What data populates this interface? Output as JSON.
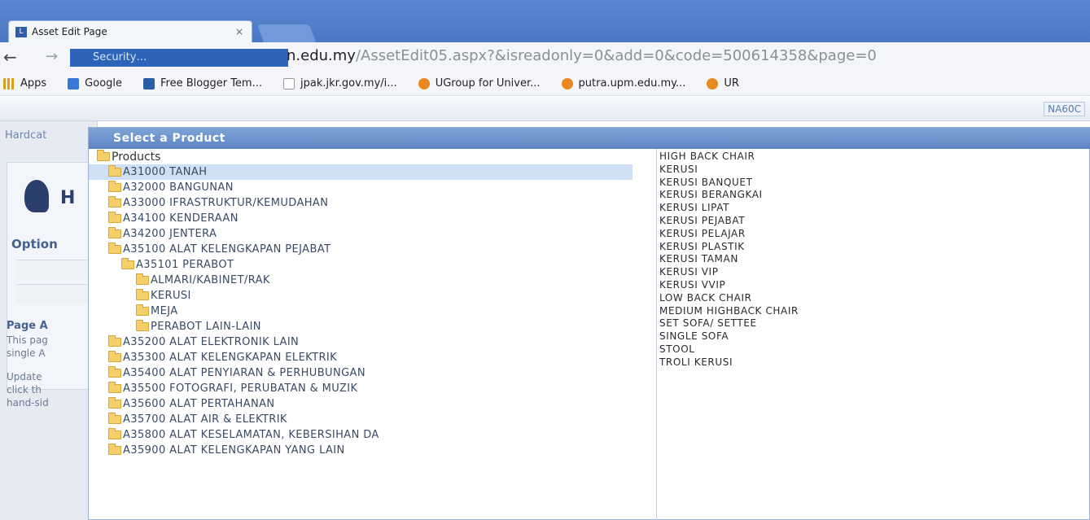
{
  "browser": {
    "tab_title": "Asset Edit Page",
    "tab_close": "×",
    "security_chip": "Security",
    "url_host": "n.edu.my",
    "url_path": "/AssetEdit05.aspx?&isreadonly=0&add=0&code=500614358&page=0",
    "bookmarks": [
      {
        "label": "Apps",
        "icon": "apps-icon"
      },
      {
        "label": "Google",
        "icon": "google-icon"
      },
      {
        "label": "Free Blogger Tem...",
        "icon": "blogger-icon"
      },
      {
        "label": "jpak.jkr.gov.my/i...",
        "icon": "page-icon"
      },
      {
        "label": "UGroup for Univer...",
        "icon": "ugroup-icon"
      },
      {
        "label": "putra.upm.edu.my...",
        "icon": "ugroup-icon"
      },
      {
        "label": "UR",
        "icon": "ugroup-icon"
      }
    ]
  },
  "page": {
    "user_badge": "NA60C",
    "tab_label": "Hardcat",
    "logo_letter": "H",
    "options_label": "Option",
    "page_as_label": "Page A",
    "info_lines": [
      "This pag",
      "single A",
      "",
      "Update",
      "click th",
      "hand-sid"
    ]
  },
  "popup": {
    "title": "Select a Product",
    "tree": [
      {
        "label": "Products",
        "level": 0,
        "selected": false,
        "root": true
      },
      {
        "label": "A31000 TANAH",
        "level": 1,
        "selected": true
      },
      {
        "label": "A32000 BANGUNAN",
        "level": 1,
        "selected": false
      },
      {
        "label": "A33000 IFRASTRUKTUR/KEMUDAHAN",
        "level": 1,
        "selected": false
      },
      {
        "label": "A34100 KENDERAAN",
        "level": 1,
        "selected": false
      },
      {
        "label": "A34200 JENTERA",
        "level": 1,
        "selected": false
      },
      {
        "label": "A35100 ALAT KELENGKAPAN PEJABAT",
        "level": 1,
        "selected": false
      },
      {
        "label": "A35101 PERABOT",
        "level": 2,
        "selected": false
      },
      {
        "label": "ALMARI/KABINET/RAK",
        "level": 3,
        "selected": false
      },
      {
        "label": "KERUSI",
        "level": 3,
        "selected": false
      },
      {
        "label": "MEJA",
        "level": 3,
        "selected": false
      },
      {
        "label": "PERABOT LAIN-LAIN",
        "level": 3,
        "selected": false
      },
      {
        "label": "A35200 ALAT ELEKTRONIK LAIN",
        "level": 1,
        "selected": false
      },
      {
        "label": "A35300 ALAT KELENGKAPAN ELEKTRIK",
        "level": 1,
        "selected": false
      },
      {
        "label": "A35400 ALAT PENYIARAN & PERHUBUNGAN",
        "level": 1,
        "selected": false
      },
      {
        "label": "A35500 FOTOGRAFI, PERUBATAN & MUZIK",
        "level": 1,
        "selected": false
      },
      {
        "label": "A35600 ALAT PERTAHANAN",
        "level": 1,
        "selected": false
      },
      {
        "label": "A35700 ALAT AIR & ELEKTRIK",
        "level": 1,
        "selected": false
      },
      {
        "label": "A35800 ALAT KESELAMATAN, KEBERSIHAN DA",
        "level": 1,
        "selected": false
      },
      {
        "label": "A35900 ALAT KELENGKAPAN YANG LAIN",
        "level": 1,
        "selected": false
      }
    ],
    "products": [
      "HIGH BACK CHAIR",
      "KERUSI",
      "KERUSI BANQUET",
      "KERUSI BERANGKAI",
      "KERUSI LIPAT",
      "KERUSI PEJABAT",
      "KERUSI PELAJAR",
      "KERUSI PLASTIK",
      "KERUSI TAMAN",
      "KERUSI VIP",
      "KERUSI VVIP",
      "LOW BACK CHAIR",
      "MEDIUM HIGHBACK CHAIR",
      "SET SOFA/ SETTEE",
      "SINGLE SOFA",
      "STOOL",
      "TROLI KERUSI"
    ]
  }
}
